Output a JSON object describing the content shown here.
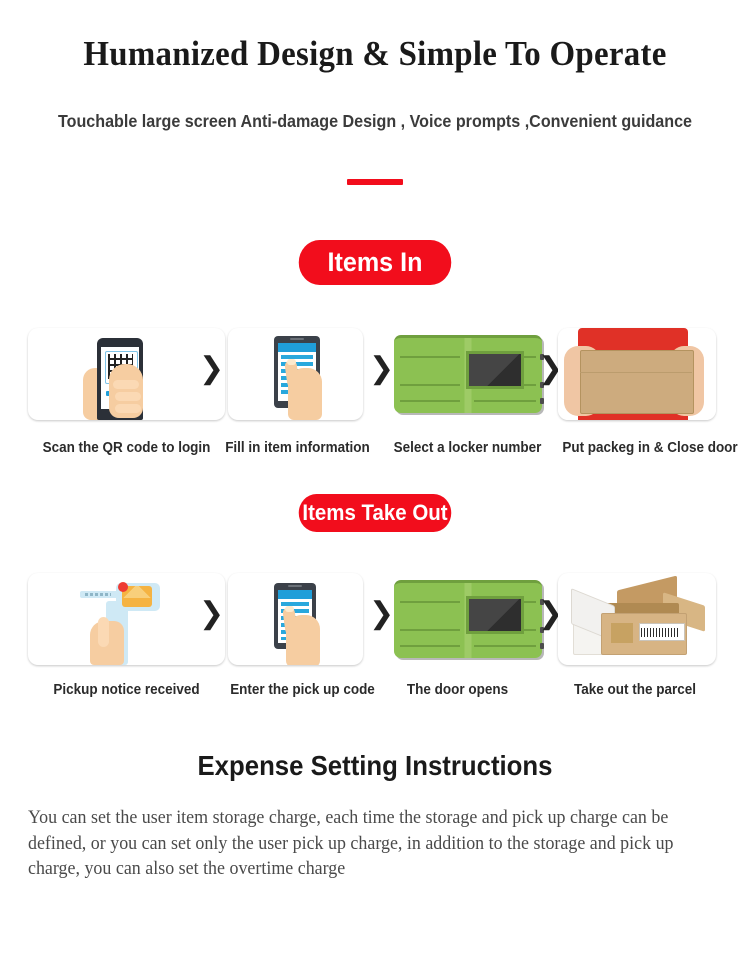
{
  "header": {
    "title": "Humanized Design  &  Simple To Operate",
    "subtitle": "Touchable large screen Anti-damage Design , Voice prompts  ,Convenient guidance"
  },
  "theme": {
    "accent_red": "#F20D1C",
    "locker_green": "#8CC152",
    "screen_blue": "#1F9ED9",
    "text_dark": "#231F20"
  },
  "sections": [
    {
      "badge": "Items In",
      "steps": [
        {
          "caption": "Scan the QR code to login",
          "art": "qr-phone-scan-illustration"
        },
        {
          "caption": "Fill in item information",
          "art": "tablet-form-tap-illustration"
        },
        {
          "caption": "Select a locker number",
          "art": "green-locker-cabinet-illustration"
        },
        {
          "caption": "Put packeg in &  Close door",
          "art": "courier-holding-box-photo"
        }
      ],
      "separator": "chevron-right-icon"
    },
    {
      "badge": "Items Take Out",
      "steps": [
        {
          "caption": "Pickup notice received",
          "art": "phone-notification-envelope-illustration"
        },
        {
          "caption": "Enter the pick up code",
          "art": "tablet-form-tap-illustration"
        },
        {
          "caption": "The door opens",
          "art": "green-locker-cabinet-illustration"
        },
        {
          "caption": "Take out the parcel",
          "art": "open-box-barcode-illustration"
        }
      ],
      "separator": "chevron-right-icon"
    }
  ],
  "expense": {
    "title": "Expense Setting Instructions",
    "body": "You can set the user item storage charge, each time the storage and pick up charge can be defined, or you can set only the user pick up charge, in addition to the storage and pick up charge, you can also set the overtime charge"
  },
  "icons": {
    "chevron": "❯"
  }
}
